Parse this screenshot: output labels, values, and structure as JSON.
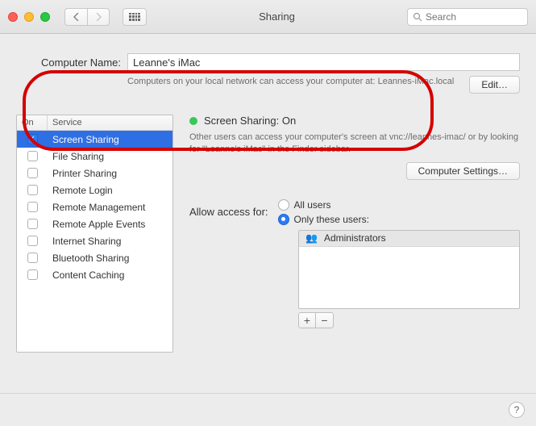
{
  "window": {
    "title": "Sharing",
    "search_placeholder": "Search"
  },
  "computer_name": {
    "label": "Computer Name:",
    "value": "Leanne's iMac",
    "subtext": "Computers on your local network can access your computer at: Leannes-iMac.local",
    "edit_label": "Edit…"
  },
  "columns": {
    "on": "On",
    "service": "Service"
  },
  "services": [
    {
      "label": "Screen Sharing",
      "on": true,
      "selected": true
    },
    {
      "label": "File Sharing",
      "on": false,
      "selected": false
    },
    {
      "label": "Printer Sharing",
      "on": false,
      "selected": false
    },
    {
      "label": "Remote Login",
      "on": false,
      "selected": false
    },
    {
      "label": "Remote Management",
      "on": false,
      "selected": false
    },
    {
      "label": "Remote Apple Events",
      "on": false,
      "selected": false
    },
    {
      "label": "Internet Sharing",
      "on": false,
      "selected": false
    },
    {
      "label": "Bluetooth Sharing",
      "on": false,
      "selected": false
    },
    {
      "label": "Content Caching",
      "on": false,
      "selected": false
    }
  ],
  "status": {
    "title": "Screen Sharing: On",
    "description": "Other users can access your computer's screen at vnc://leannes-imac/ or by looking for \"Leanne's iMac\" in the Finder sidebar.",
    "settings_label": "Computer Settings…"
  },
  "access": {
    "label": "Allow access for:",
    "options": {
      "all": "All users",
      "only": "Only these users:"
    },
    "selected": "only",
    "users": [
      "Administrators"
    ]
  },
  "buttons": {
    "plus": "+",
    "minus": "−",
    "help": "?"
  },
  "colors": {
    "accent": "#2f6fe4",
    "status_on": "#38c759",
    "annotation": "#d40000"
  }
}
